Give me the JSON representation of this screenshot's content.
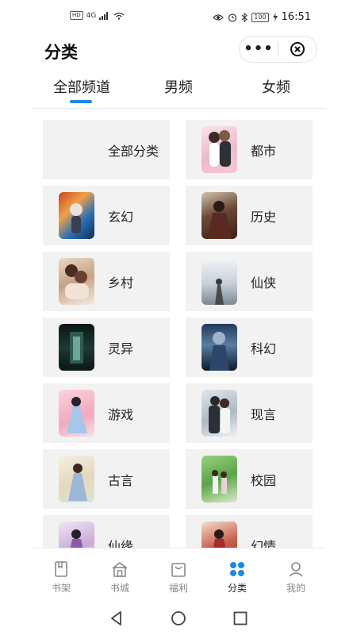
{
  "status_bar": {
    "left_badge": "HD",
    "network": "4G",
    "battery": "100",
    "time": "16:51"
  },
  "header": {
    "title": "分类",
    "more_label": "•••"
  },
  "tabs": [
    {
      "label": "全部频道",
      "active": true
    },
    {
      "label": "男频",
      "active": false
    },
    {
      "label": "女频",
      "active": false
    }
  ],
  "categories": [
    {
      "label": "全部分类",
      "cover": "none"
    },
    {
      "label": "都市",
      "cover": "pink-couple"
    },
    {
      "label": "玄幻",
      "cover": "fire-ice-warriors"
    },
    {
      "label": "历史",
      "cover": "dark-armored-lord"
    },
    {
      "label": "乡村",
      "cover": "romance-couple"
    },
    {
      "label": "仙侠",
      "cover": "misty-swordsman"
    },
    {
      "label": "灵异",
      "cover": "haunted-corridor"
    },
    {
      "label": "科幻",
      "cover": "blue-giant-figure"
    },
    {
      "label": "游戏",
      "cover": "pink-fairy"
    },
    {
      "label": "现言",
      "cover": "suit-couple"
    },
    {
      "label": "古言",
      "cover": "ancient-maiden"
    },
    {
      "label": "校园",
      "cover": "green-garden-couple"
    },
    {
      "label": "仙缘",
      "cover": "purple-fairy"
    },
    {
      "label": "幻情",
      "cover": "red-ancient-lady"
    }
  ],
  "bottom_nav": [
    {
      "label": "书架",
      "icon": "bookshelf-icon",
      "active": false
    },
    {
      "label": "书城",
      "icon": "bookstore-icon",
      "active": false
    },
    {
      "label": "福利",
      "icon": "welfare-bag-icon",
      "active": false
    },
    {
      "label": "分类",
      "icon": "category-dots-icon",
      "active": true
    },
    {
      "label": "我的",
      "icon": "profile-icon",
      "active": false
    }
  ],
  "colors": {
    "accent": "#1e88e5",
    "card_bg": "#f2f2f2",
    "inactive_text": "#888888"
  }
}
